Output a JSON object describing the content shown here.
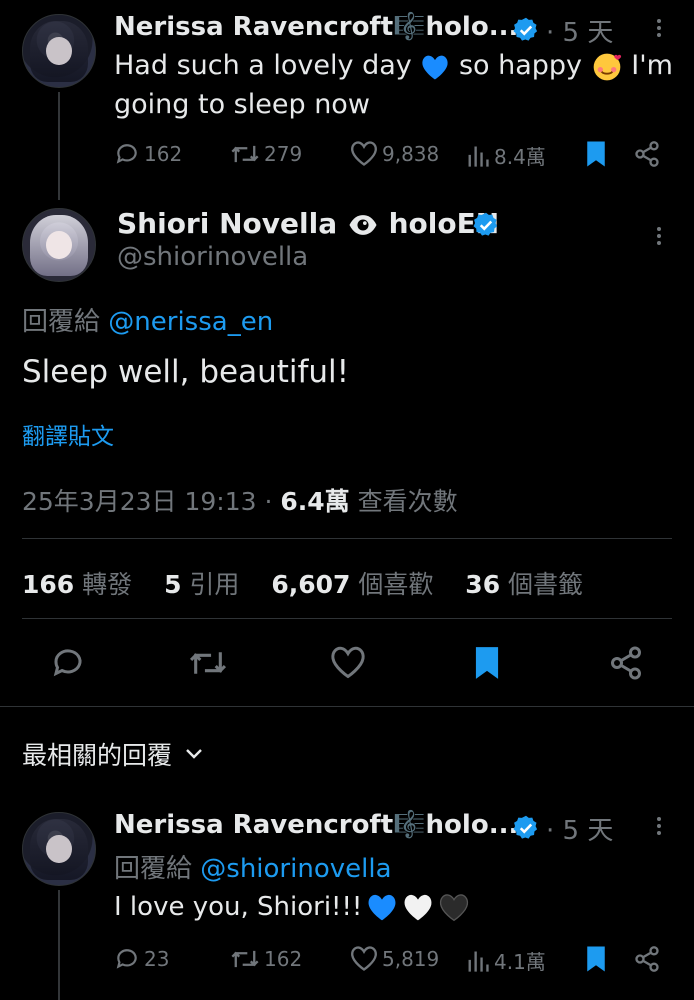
{
  "post1": {
    "author": "Nerissa Ravencroft🎼holo...",
    "time": "5 天",
    "text": "Had such a lovely day 💙 so happy 🥰 I'm going to sleep now",
    "line1": "Had such a lovely day",
    "line1b": "so happy",
    "line1c": "I'm",
    "line2": "going to sleep now",
    "replies": "162",
    "reposts": "279",
    "likes": "9,838",
    "views": "8.4萬"
  },
  "main": {
    "author": "Shiori Novella 👁 holoEN",
    "author_name": "Shiori Novella",
    "author_suffix": "holoEN",
    "handle": "@shiorinovella",
    "reply_prefix": "回覆給",
    "reply_to": "@nerissa_en",
    "text": "Sleep well, beautiful!",
    "translate": "翻譯貼文",
    "datetime": "25年3月23日 19:13",
    "views_count": "6.4萬",
    "views_label": "查看次數",
    "stats": {
      "reposts_count": "166",
      "reposts_label": "轉發",
      "quotes_count": "5",
      "quotes_label": "引用",
      "likes_count": "6,607",
      "likes_label": "個喜歡",
      "bookmarks_count": "36",
      "bookmarks_label": "個書籤"
    }
  },
  "sort": {
    "label": "最相關的回覆"
  },
  "reply1": {
    "author": "Nerissa Ravencroft🎼holo...",
    "time": "5 天",
    "reply_prefix": "回覆給",
    "reply_to": "@shiorinovella",
    "text": "I love you, Shiori!!! 💙🤍🖤",
    "text_plain": "I love you, Shiori!!!",
    "replies": "23",
    "reposts": "162",
    "likes": "5,819",
    "views": "4.1萬"
  },
  "colors": {
    "accent": "#1d9bf0",
    "muted": "#71767b",
    "bg": "#000000",
    "text": "#e7e9ea"
  },
  "icons": [
    "reply-icon",
    "repost-icon",
    "like-icon",
    "views-icon",
    "bookmark-icon",
    "share-icon",
    "verified-icon",
    "more-icon",
    "chevron-down-icon"
  ]
}
